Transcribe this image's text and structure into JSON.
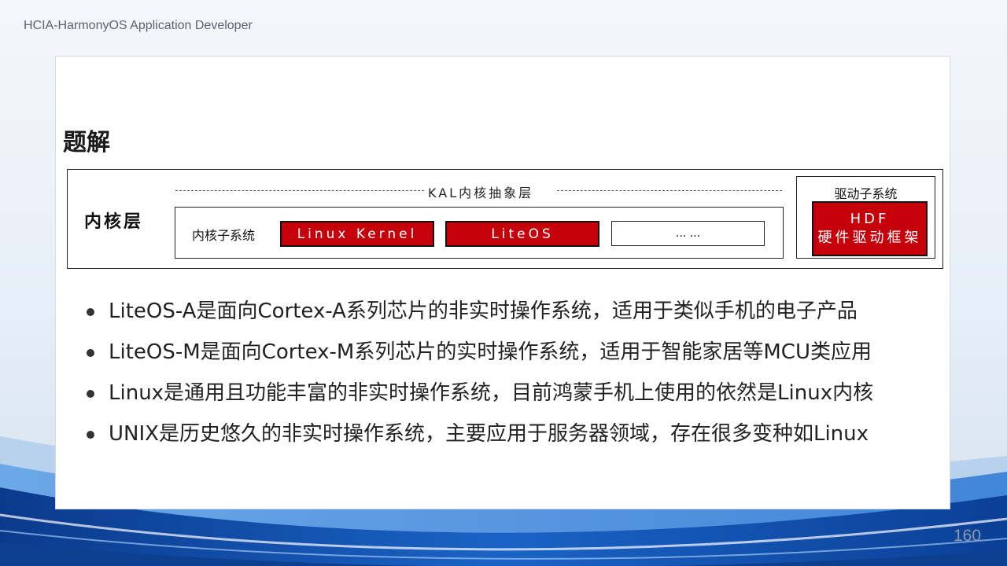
{
  "header": {
    "course_title": "HCIA-HarmonyOS Application Developer"
  },
  "slide": {
    "title": "题解",
    "diagram": {
      "kernel_layer_label": "内核层",
      "kal_label": "KAL内核抽象层",
      "kernel_subsystem_label": "内核子系统",
      "kernels": [
        "Linux Kernel",
        "LiteOS"
      ],
      "more_label": "... ...",
      "driver_subsystem_label": "驱动子系统",
      "hdf_line1": "HDF",
      "hdf_line2": "硬件驱动框架",
      "accent_color": "#c5000b"
    },
    "bullets": [
      "LiteOS-A是面向Cortex-A系列芯片的非实时操作系统，适用于类似手机的电子产品",
      "LiteOS-M是面向Cortex-M系列芯片的实时操作系统，适用于智能家居等MCU类应用",
      "Linux是通用且功能丰富的非实时操作系统，目前鸿蒙手机上使用的依然是Linux内核",
      "UNIX是历史悠久的非实时操作系统，主要应用于服务器领域，存在很多变种如Linux"
    ]
  },
  "footer": {
    "page_number": "160"
  }
}
